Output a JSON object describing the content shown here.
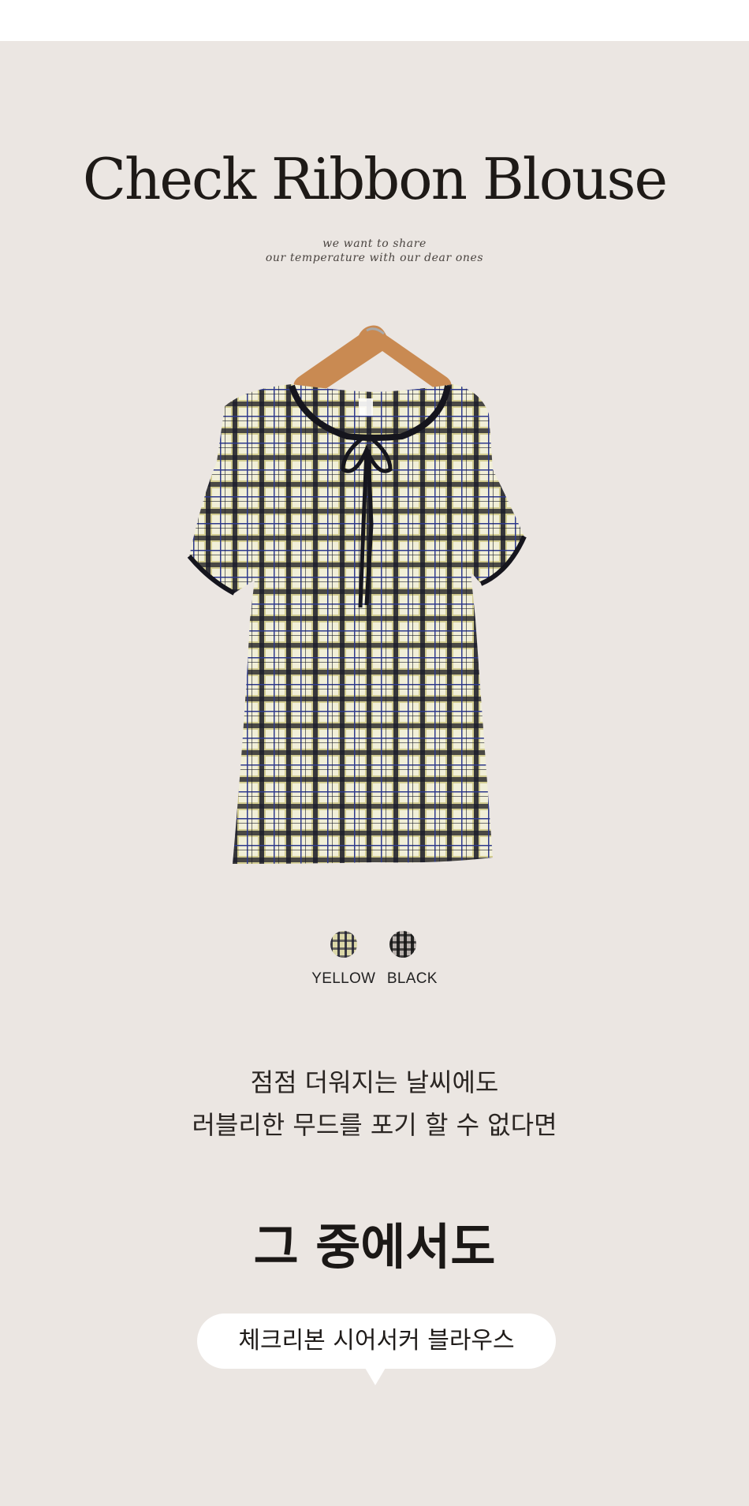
{
  "header": {
    "title": "Check Ribbon Blouse",
    "tagline_lines": [
      "we want to share",
      "our temperature with our dear ones"
    ]
  },
  "product_image": {
    "icon": "plaid-blouse-on-hanger-icon"
  },
  "colors": {
    "swatches": [
      {
        "label": "YELLOW",
        "icon": "yellow-plaid-swatch-icon",
        "color": "#dcd8a8"
      },
      {
        "label": "BLACK",
        "icon": "black-plaid-swatch-icon",
        "color": "#b9b2ae"
      }
    ]
  },
  "copy": {
    "lines": [
      "점점 더워지는 날씨에도",
      "러블리한 무드를 포기 할 수 없다면"
    ]
  },
  "headline": {
    "text": "그 중에서도"
  },
  "bubble": {
    "text": "체크리본 시어서커 블라우스"
  },
  "theme": {
    "background": "#ebe6e2",
    "text": "#1e1a17",
    "bubble": "#ffffff"
  }
}
